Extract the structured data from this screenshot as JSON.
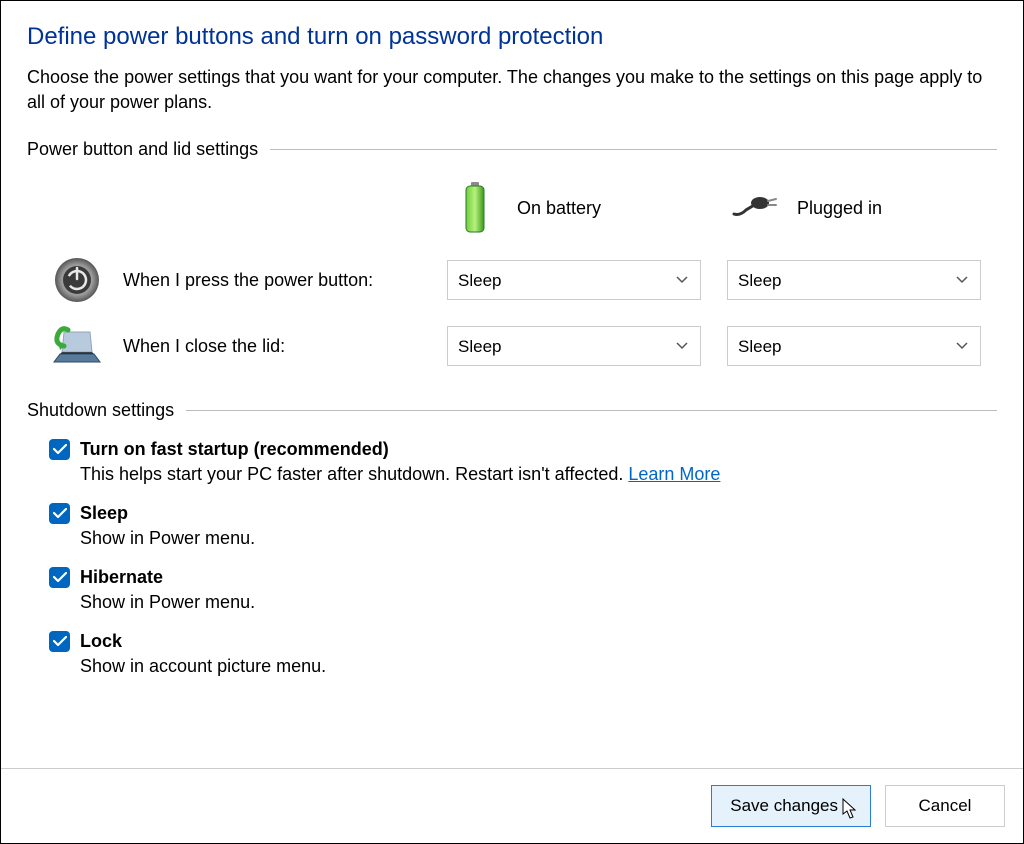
{
  "header": {
    "title": "Define power buttons and turn on password protection",
    "description": "Choose the power settings that you want for your computer. The changes you make to the settings on this page apply to all of your power plans."
  },
  "power_section": {
    "title": "Power button and lid settings",
    "columns": {
      "battery": "On battery",
      "plugged": "Plugged in"
    },
    "rows": [
      {
        "label": "When I press the power button:",
        "battery_value": "Sleep",
        "plugged_value": "Sleep"
      },
      {
        "label": "When I close the lid:",
        "battery_value": "Sleep",
        "plugged_value": "Sleep"
      }
    ]
  },
  "shutdown_section": {
    "title": "Shutdown settings",
    "items": [
      {
        "label": "Turn on fast startup (recommended)",
        "description": "This helps start your PC faster after shutdown. Restart isn't affected. ",
        "link": "Learn More",
        "checked": true
      },
      {
        "label": "Sleep",
        "description": "Show in Power menu.",
        "checked": true
      },
      {
        "label": "Hibernate",
        "description": "Show in Power menu.",
        "checked": true
      },
      {
        "label": "Lock",
        "description": "Show in account picture menu.",
        "checked": true
      }
    ]
  },
  "footer": {
    "save": "Save changes",
    "cancel": "Cancel"
  }
}
